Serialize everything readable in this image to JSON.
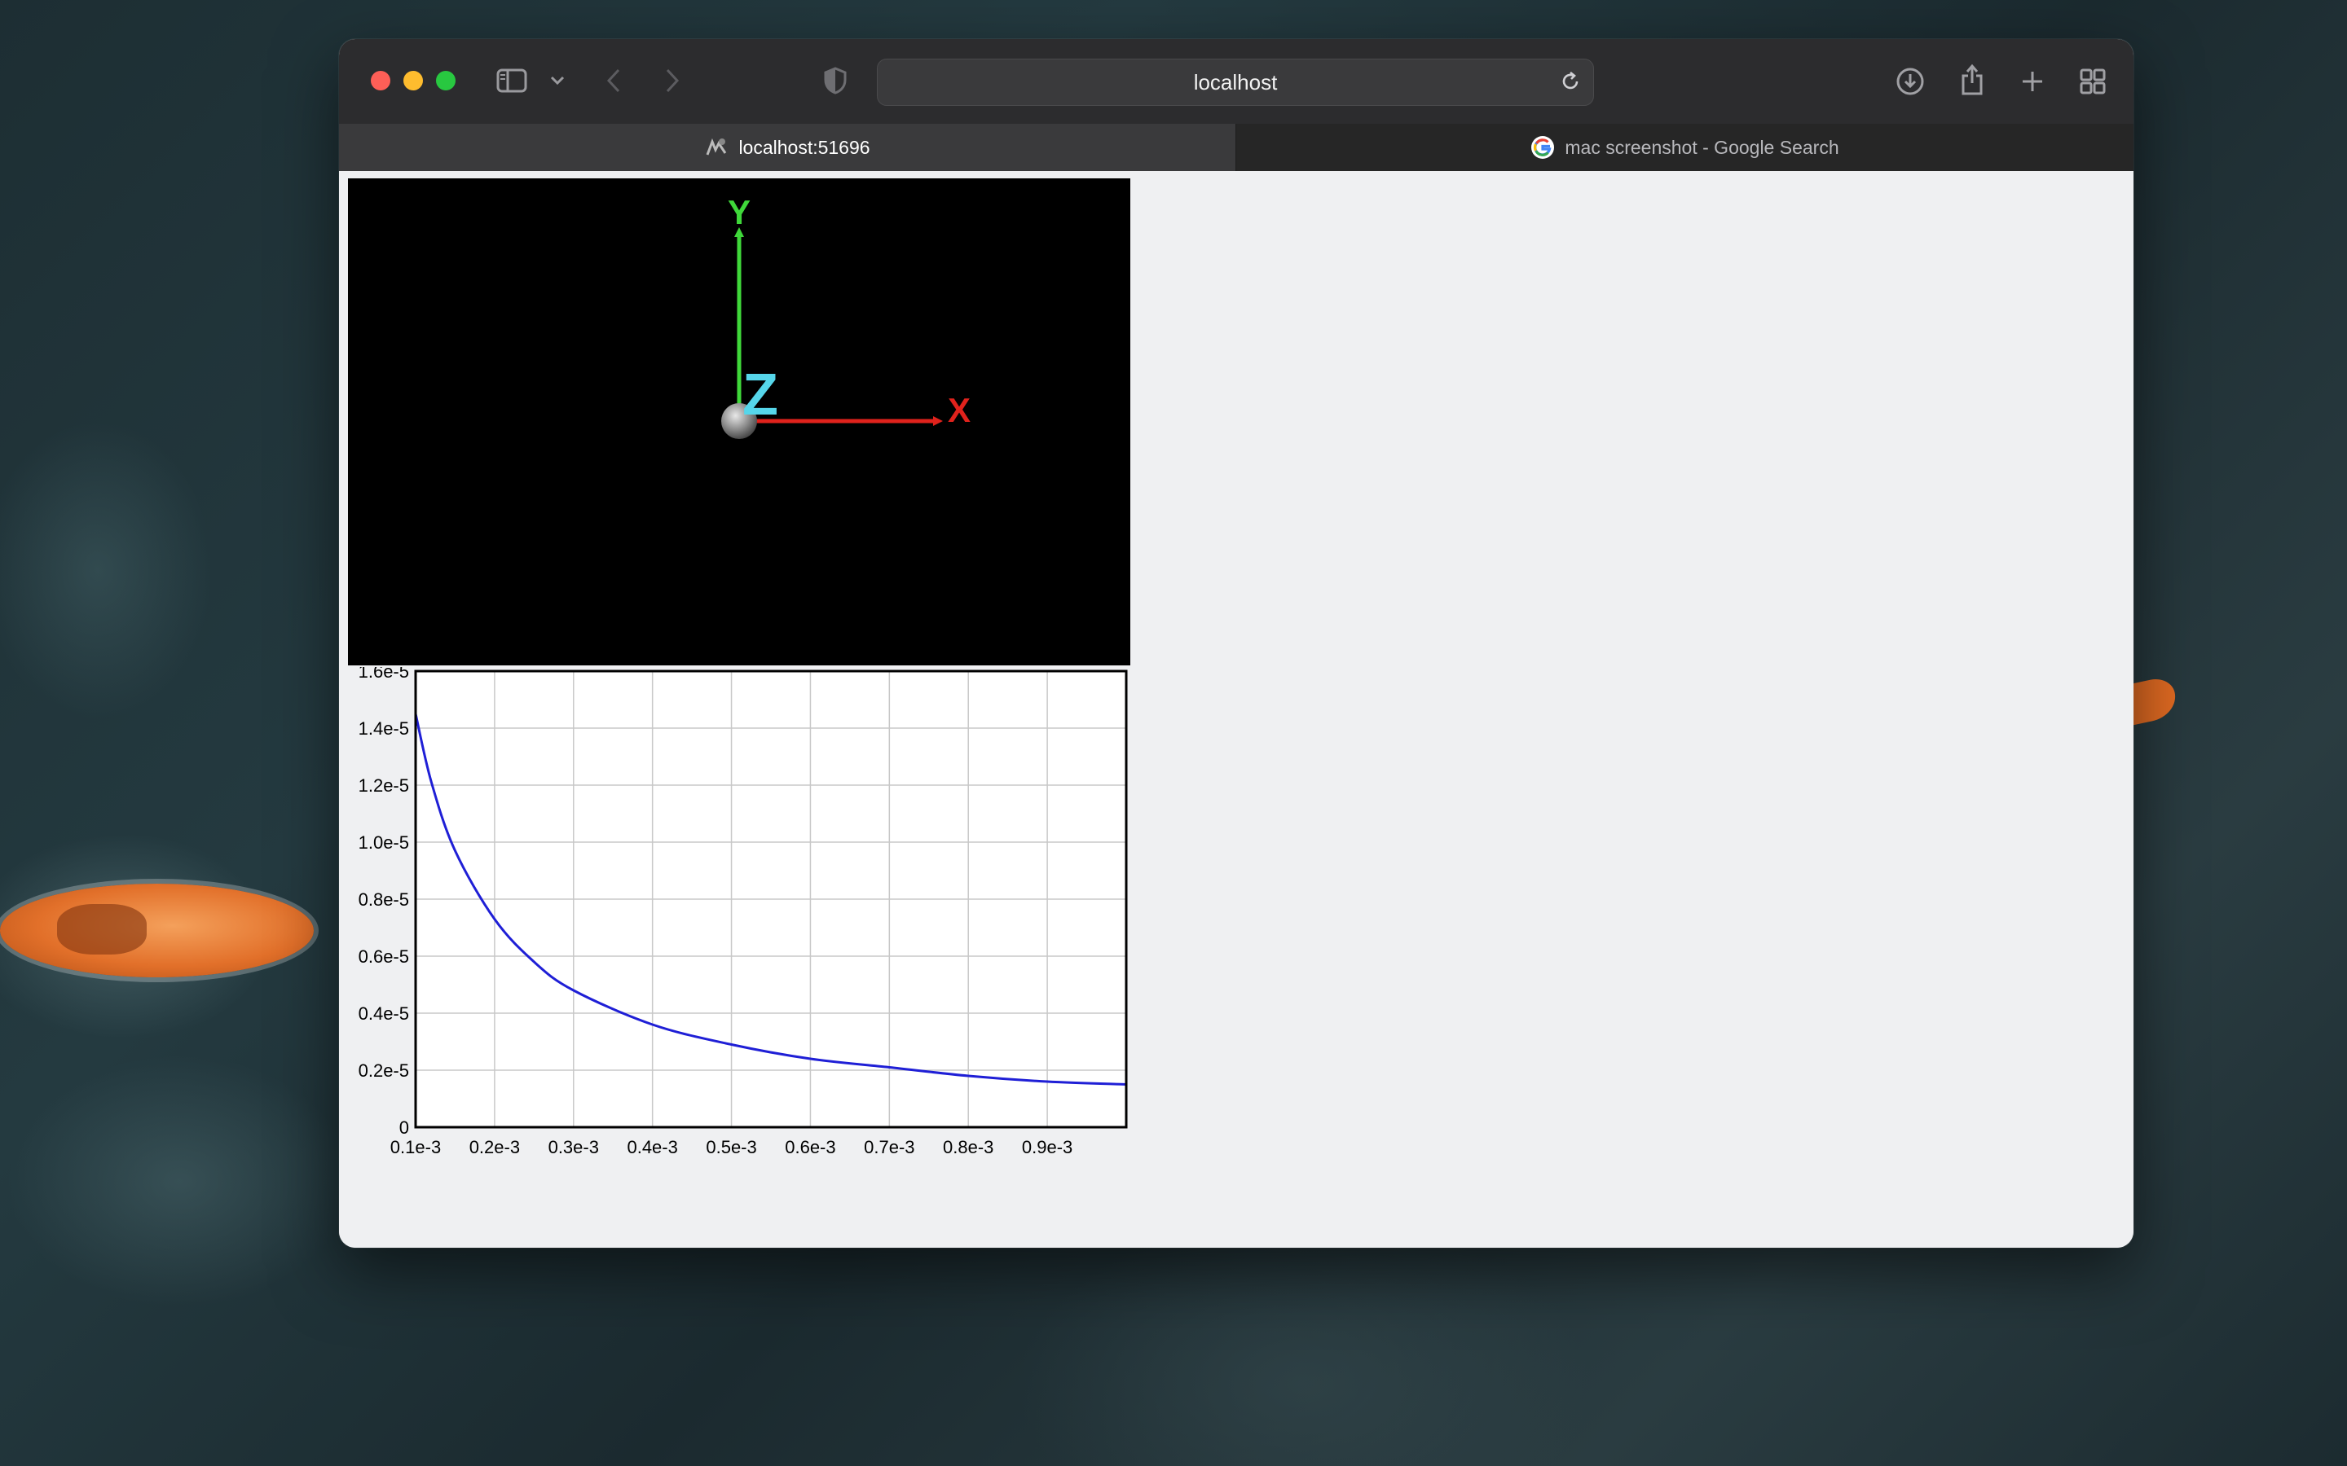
{
  "browser": {
    "url": "localhost",
    "tabs": [
      {
        "label": "localhost:51696",
        "active": true
      },
      {
        "label": "mac screenshot - Google Search",
        "active": false
      }
    ]
  },
  "scene": {
    "axis_labels": {
      "x": "X",
      "y": "Y",
      "z": "Z"
    },
    "colors": {
      "x": "#e0221c",
      "y": "#3fd83a",
      "z": "#56d6ea",
      "background": "#000000"
    }
  },
  "chart_data": {
    "type": "line",
    "xlim": [
      0.0001,
      0.001
    ],
    "ylim": [
      0,
      1.6e-05
    ],
    "x_ticks": [
      "0.1e-3",
      "0.2e-3",
      "0.3e-3",
      "0.4e-3",
      "0.5e-3",
      "0.6e-3",
      "0.7e-3",
      "0.8e-3",
      "0.9e-3"
    ],
    "y_ticks": [
      "0",
      "0.2e-5",
      "0.4e-5",
      "0.6e-5",
      "0.8e-5",
      "1.0e-5",
      "1.2e-5",
      "1.4e-5",
      "1.6e-5"
    ],
    "grid": true,
    "series": [
      {
        "color": "#1f1fd6",
        "x": [
          0.0001,
          0.00012,
          0.00015,
          0.0002,
          0.00025,
          0.0003,
          0.0004,
          0.0005,
          0.0006,
          0.0007,
          0.0008,
          0.0009,
          0.001
        ],
        "y": [
          1.45e-05,
          1.21e-05,
          9.7e-06,
          7.3e-06,
          5.8e-06,
          4.8e-06,
          3.6e-06,
          2.9e-06,
          2.4e-06,
          2.1e-06,
          1.8e-06,
          1.6e-06,
          1.5e-06
        ]
      }
    ]
  }
}
